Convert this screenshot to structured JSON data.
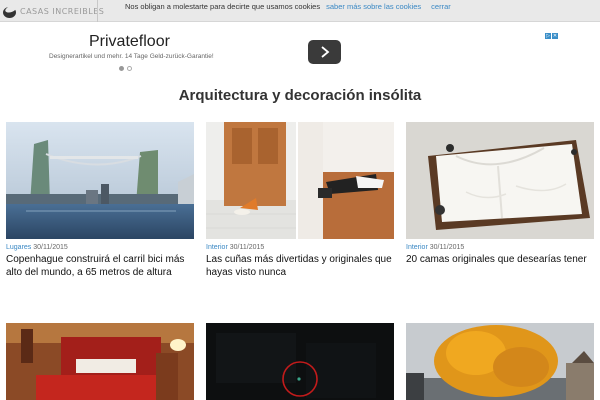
{
  "header": {
    "logo_text": "CASAS INCREIBLES"
  },
  "cookie_bar": {
    "message": "Nos obligan a molestarte para decirte que usamos cookies",
    "more_link": "saber más sobre las cookies",
    "close_link": "cerrar"
  },
  "ad": {
    "title": "Privatefloor",
    "subtitle": "Designerartikel und mehr. 14 Tage Geld-zurück-Garantie!",
    "button_icon": "chevron-right-icon",
    "choices_icons": [
      "ad-choices-icon",
      "close-icon"
    ],
    "dots_total": 2,
    "dots_active": 1
  },
  "section": {
    "title": "Arquitectura y decoración insólita"
  },
  "articles": [
    {
      "category": "Lugares",
      "date": "30/11/2015",
      "title": "Copenhague construirá el carril bici más alto del mundo, a 65 metros de altura"
    },
    {
      "category": "Interior",
      "date": "30/11/2015",
      "title": "Las cuñas más divertidas y originales que hayas visto nunca"
    },
    {
      "category": "Interior",
      "date": "30/11/2015",
      "title": "20 camas originales que desearías tener"
    }
  ],
  "colors": {
    "link": "#3a88c4",
    "header_bg": "#e9e9e9",
    "text": "#222222"
  }
}
